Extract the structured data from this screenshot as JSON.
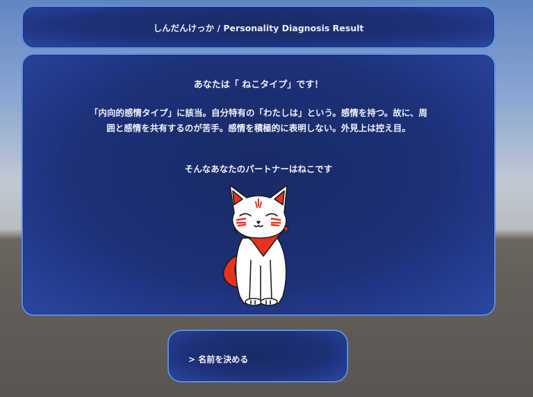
{
  "header": {
    "title": "しんだんけっか / Personality Diagnosis Result"
  },
  "result": {
    "headline": "あなたは「 ねこタイプ」です！",
    "description_line1": "「内向的感情タイプ」に該当。自分特有の「わたしは」という。感情を持つ。故に、周",
    "description_line2": "囲と感情を共有するのが苦手。感情を積極的に表明しない。外見上は控え目。",
    "partner_text": "そんなあなたのパートナーはねこです",
    "partner_image": "white-cat-red-bandana-icon"
  },
  "action": {
    "label": "> 名前を決める"
  },
  "colors": {
    "panel_border": "#5b8ee8",
    "panel_fill": "#1d3078",
    "accent_red": "#e8321e",
    "text": "#eef2fa"
  }
}
